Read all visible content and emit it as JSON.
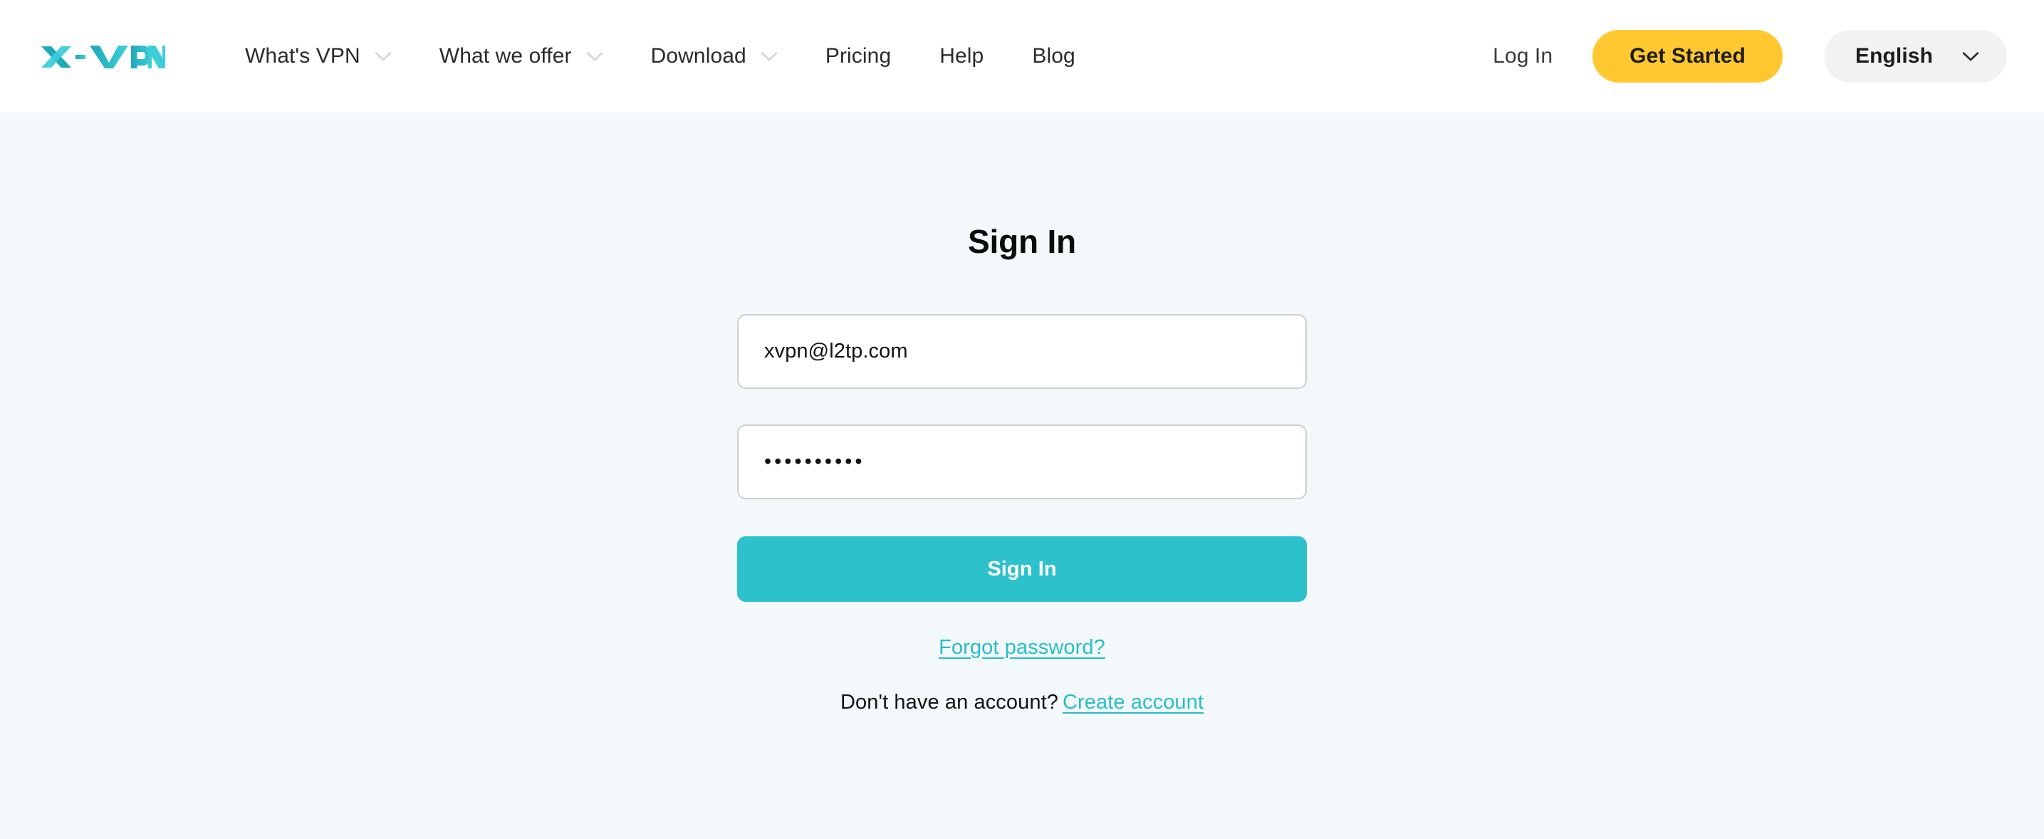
{
  "brand": {
    "logo_text": "X-VPN",
    "logo_color_dark": "#1fa8b8",
    "logo_color_light": "#3ccfd9"
  },
  "colors": {
    "page_background": "#f3f8fa",
    "header_background": "#ffffff",
    "accent_teal": "#2dc2cb",
    "accent_yellow": "#ffc831",
    "link_teal": "#27bec7",
    "language_pill": "#f1f2f2",
    "input_border": "#cfcfcf",
    "text_primary": "#121212"
  },
  "header": {
    "nav": [
      {
        "label": "What's VPN",
        "has_dropdown": true,
        "icon": "chevron-down-icon"
      },
      {
        "label": "What we offer",
        "has_dropdown": true,
        "icon": "chevron-down-icon"
      },
      {
        "label": "Download",
        "has_dropdown": true,
        "icon": "chevron-down-icon"
      },
      {
        "label": "Pricing",
        "has_dropdown": false,
        "icon": ""
      },
      {
        "label": "Help",
        "has_dropdown": false,
        "icon": ""
      },
      {
        "label": "Blog",
        "has_dropdown": false,
        "icon": ""
      }
    ],
    "login_label": "Log In",
    "get_started_label": "Get Started",
    "language": {
      "selected": "English",
      "icon": "chevron-down-icon"
    }
  },
  "signin": {
    "title": "Sign In",
    "email": {
      "value": "xvpn@l2tp.com",
      "placeholder": "Email"
    },
    "password": {
      "value": "••••••••••",
      "placeholder": "Password",
      "masked_length": 10
    },
    "submit_label": "Sign In",
    "forgot_password_label": "Forgot password?",
    "signup_prompt": "Don't have an account?",
    "create_account_label": "Create account"
  }
}
